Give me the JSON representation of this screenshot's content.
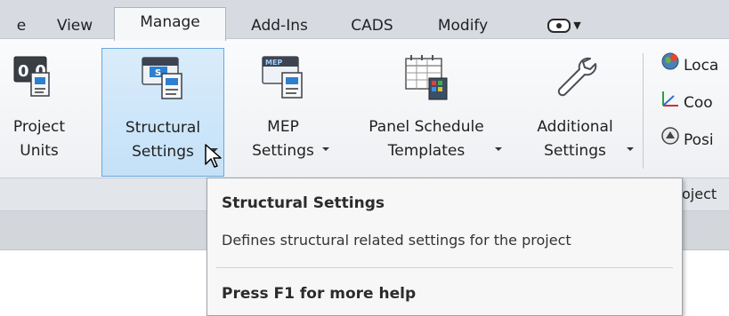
{
  "tabs": [
    {
      "label": "e",
      "active": false
    },
    {
      "label": "View",
      "active": false
    },
    {
      "label": "Manage",
      "active": true
    },
    {
      "label": "Add-Ins",
      "active": false
    },
    {
      "label": "CADS",
      "active": false
    },
    {
      "label": "Modify",
      "active": false
    },
    {
      "label": "",
      "icon": "mouse-icon",
      "active": false
    }
  ],
  "ribbon": {
    "buttons": [
      {
        "line1": "Project",
        "line2": "Units",
        "icon": "project-units-icon",
        "icon_text": "0.0"
      },
      {
        "line1": "Structural",
        "line2": "Settings",
        "icon": "structural-settings-icon",
        "icon_text": "S",
        "highlighted": true
      },
      {
        "line1": "MEP",
        "line2": "Settings",
        "icon": "mep-settings-icon",
        "icon_text": "MEP"
      },
      {
        "line1": "Panel Schedule",
        "line2": "Templates",
        "icon": "panel-schedule-templates-icon"
      },
      {
        "line1": "Additional",
        "line2": "Settings",
        "icon": "wrench-icon"
      }
    ],
    "side_items": [
      {
        "label": "Loca",
        "icon": "location-globe-icon"
      },
      {
        "label": "Coo",
        "icon": "coordinates-icon"
      },
      {
        "label": "Posi",
        "icon": "position-icon"
      }
    ],
    "panel_title": "oject"
  },
  "tooltip": {
    "title": "Structural Settings",
    "description": "Defines structural related settings for the project",
    "help": "Press F1 for more help"
  },
  "colors": {
    "highlight_fill": "#c4e1f8",
    "highlight_border": "#6aa8de",
    "tab_bar": "#d7dbe1"
  }
}
